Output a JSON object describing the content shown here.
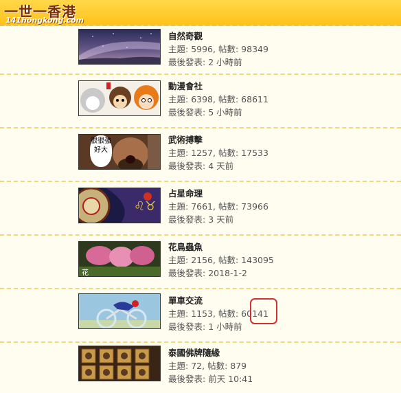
{
  "site": {
    "logo_text": "一世一香港",
    "logo_sub": "141hongkong.com"
  },
  "forums": [
    {
      "name": "自然奇觀",
      "topics_label": "主題",
      "topics": "5996",
      "posts_label": "帖數",
      "posts": "98349",
      "last_label": "最後發表",
      "last_post": "2 小時前",
      "image": "milky-way"
    },
    {
      "name": "動漫會社",
      "topics_label": "主題",
      "topics": "6398",
      "posts_label": "帖數",
      "posts": "68611",
      "last_label": "最後發表",
      "last_post": "5 小時前",
      "image": "anime-characters"
    },
    {
      "name": "武術搏擊",
      "topics_label": "主題",
      "topics": "1257",
      "posts_label": "帖數",
      "posts": "17533",
      "last_label": "最後發表",
      "last_post": "4 天前",
      "image": "warrior-shout",
      "image_text": "很很強好大"
    },
    {
      "name": "占星命理",
      "topics_label": "主題",
      "topics": "7661",
      "posts_label": "帖數",
      "posts": "73966",
      "last_label": "最後發表",
      "last_post": "3 天前",
      "image": "zodiac-wheel"
    },
    {
      "name": "花鳥蟲魚",
      "topics_label": "主題",
      "topics": "2156",
      "posts_label": "帖數",
      "posts": "143095",
      "last_label": "最後發表",
      "last_post": "2018-1-2",
      "image": "pink-flowers",
      "image_text": "花"
    },
    {
      "name": "單車交流",
      "topics_label": "主題",
      "topics": "1153",
      "posts_label": "帖數",
      "posts": "60141",
      "last_label": "最後發表",
      "last_post": "1 小時前",
      "image": "cyclist",
      "highlighted": true
    },
    {
      "name": "泰國佛牌隨緣",
      "topics_label": "主題",
      "topics": "72",
      "posts_label": "帖數",
      "posts": "879",
      "last_label": "最後發表",
      "last_post": "前天 10:41",
      "image": "amulets"
    }
  ]
}
